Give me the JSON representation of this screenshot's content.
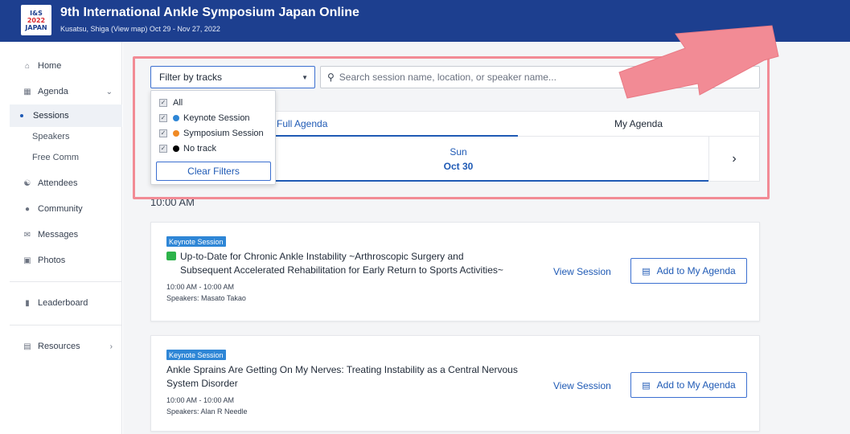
{
  "header": {
    "logo_line1": "I&S",
    "logo_line2": "2022",
    "logo_line3": "JAPAN",
    "title": "9th International Ankle Symposium Japan Online",
    "subtitle": "Kusatsu, Shiga (View map)  Oct 29 - Nov 27, 2022"
  },
  "sidebar": {
    "items": [
      {
        "label": "Home"
      },
      {
        "label": "Agenda"
      },
      {
        "label": "Sessions"
      },
      {
        "label": "Speakers"
      },
      {
        "label": "Free Comm"
      },
      {
        "label": "Attendees"
      },
      {
        "label": "Community"
      },
      {
        "label": "Messages"
      },
      {
        "label": "Photos"
      },
      {
        "label": "Leaderboard"
      },
      {
        "label": "Resources"
      }
    ]
  },
  "filter": {
    "label": "Filter by tracks",
    "search_placeholder": "Search session name, location, or speaker name...",
    "options": [
      {
        "label": "All",
        "color": ""
      },
      {
        "label": "Keynote Session",
        "color": "#2e86d6"
      },
      {
        "label": "Symposium Session",
        "color": "#f08a24"
      },
      {
        "label": "No track",
        "color": "#000000"
      }
    ],
    "clear_label": "Clear Filters"
  },
  "tabs": [
    {
      "label": "Full Agenda",
      "active": true
    },
    {
      "label": "My Agenda",
      "active": false
    }
  ],
  "date": {
    "day": "Sun",
    "date": "Oct 30"
  },
  "time_label": "10:00 AM",
  "sessions": [
    {
      "badge": "Keynote Session",
      "title_line1": "Up-to-Date for Chronic Ankle Instability ~Arthroscopic Surgery and",
      "title_line2": "Subsequent Accelerated Rehabilitation for Early Return to Sports Activities~",
      "time": "10:00 AM - 10:00 AM",
      "speakers": "Speakers: Masato Takao",
      "view_label": "View Session",
      "add_label": "Add to My Agenda"
    },
    {
      "badge": "Keynote Session",
      "title_line1": "Ankle Sprains Are Getting On My Nerves: Treating Instability as a Central Nervous",
      "title_line2": "System Disorder",
      "time": "10:00 AM - 10:00 AM",
      "speakers": "Speakers: Alan R Needle",
      "view_label": "View Session",
      "add_label": "Add to My Agenda"
    }
  ],
  "colors": {
    "header_bg": "#1d3f8f",
    "accent": "#1f5ab5",
    "highlight": "#f28b95"
  }
}
